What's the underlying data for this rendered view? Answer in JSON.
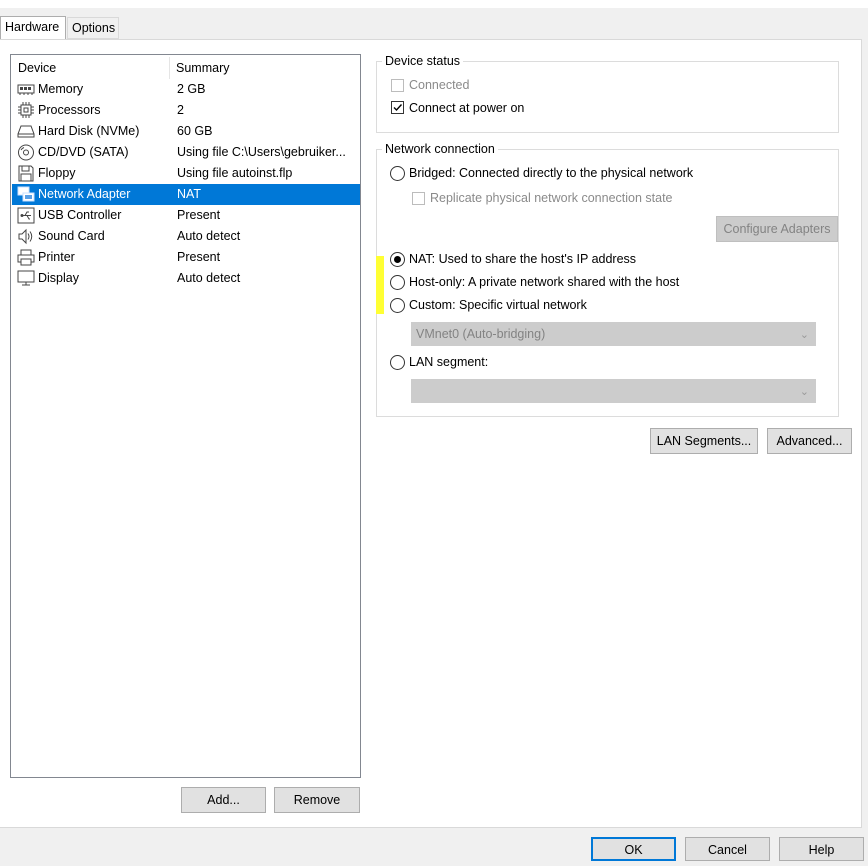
{
  "tabs": [
    {
      "label": "Hardware",
      "active": true
    },
    {
      "label": "Options",
      "active": false
    }
  ],
  "device_list": {
    "columns": [
      "Device",
      "Summary"
    ],
    "items": [
      {
        "icon": "memory-icon",
        "device": "Memory",
        "summary": "2 GB",
        "selected": false
      },
      {
        "icon": "processor-icon",
        "device": "Processors",
        "summary": "2",
        "selected": false
      },
      {
        "icon": "hard-disk-icon",
        "device": "Hard Disk (NVMe)",
        "summary": "60 GB",
        "selected": false
      },
      {
        "icon": "cd-dvd-icon",
        "device": "CD/DVD (SATA)",
        "summary": "Using file C:\\Users\\gebruiker...",
        "selected": false
      },
      {
        "icon": "floppy-icon",
        "device": "Floppy",
        "summary": "Using file autoinst.flp",
        "selected": false
      },
      {
        "icon": "network-adapter-icon",
        "device": "Network Adapter",
        "summary": "NAT",
        "selected": true
      },
      {
        "icon": "usb-icon",
        "device": "USB Controller",
        "summary": "Present",
        "selected": false
      },
      {
        "icon": "sound-card-icon",
        "device": "Sound Card",
        "summary": "Auto detect",
        "selected": false
      },
      {
        "icon": "printer-icon",
        "device": "Printer",
        "summary": "Present",
        "selected": false
      },
      {
        "icon": "display-icon",
        "device": "Display",
        "summary": "Auto detect",
        "selected": false
      }
    ]
  },
  "list_buttons": {
    "add": "Add...",
    "remove": "Remove"
  },
  "device_status": {
    "title": "Device status",
    "connected": {
      "label": "Connected",
      "checked": false,
      "enabled": false
    },
    "connect_at_power_on": {
      "label": "Connect at power on",
      "checked": true,
      "enabled": true
    }
  },
  "network_connection": {
    "title": "Network connection",
    "bridged": {
      "label": "Bridged: Connected directly to the physical network",
      "checked": false
    },
    "replicate": {
      "label": "Replicate physical network connection state",
      "checked": false,
      "enabled": false
    },
    "configure_adapters": "Configure Adapters",
    "nat": {
      "label": "NAT: Used to share the host's IP address",
      "checked": true
    },
    "host_only": {
      "label": "Host-only: A private network shared with the host",
      "checked": false
    },
    "custom": {
      "label": "Custom: Specific virtual network",
      "checked": false
    },
    "custom_select": {
      "value": "VMnet0 (Auto-bridging)",
      "enabled": false
    },
    "lan_segment": {
      "label": "LAN segment:",
      "checked": false
    },
    "lan_select": {
      "value": "",
      "enabled": false
    }
  },
  "panel_buttons": {
    "lan_segments": "LAN Segments...",
    "advanced": "Advanced..."
  },
  "dialog_buttons": {
    "ok": "OK",
    "cancel": "Cancel",
    "help": "Help"
  },
  "colors": {
    "selection": "#0078d7",
    "annotation_highlight": "#ffff33"
  }
}
